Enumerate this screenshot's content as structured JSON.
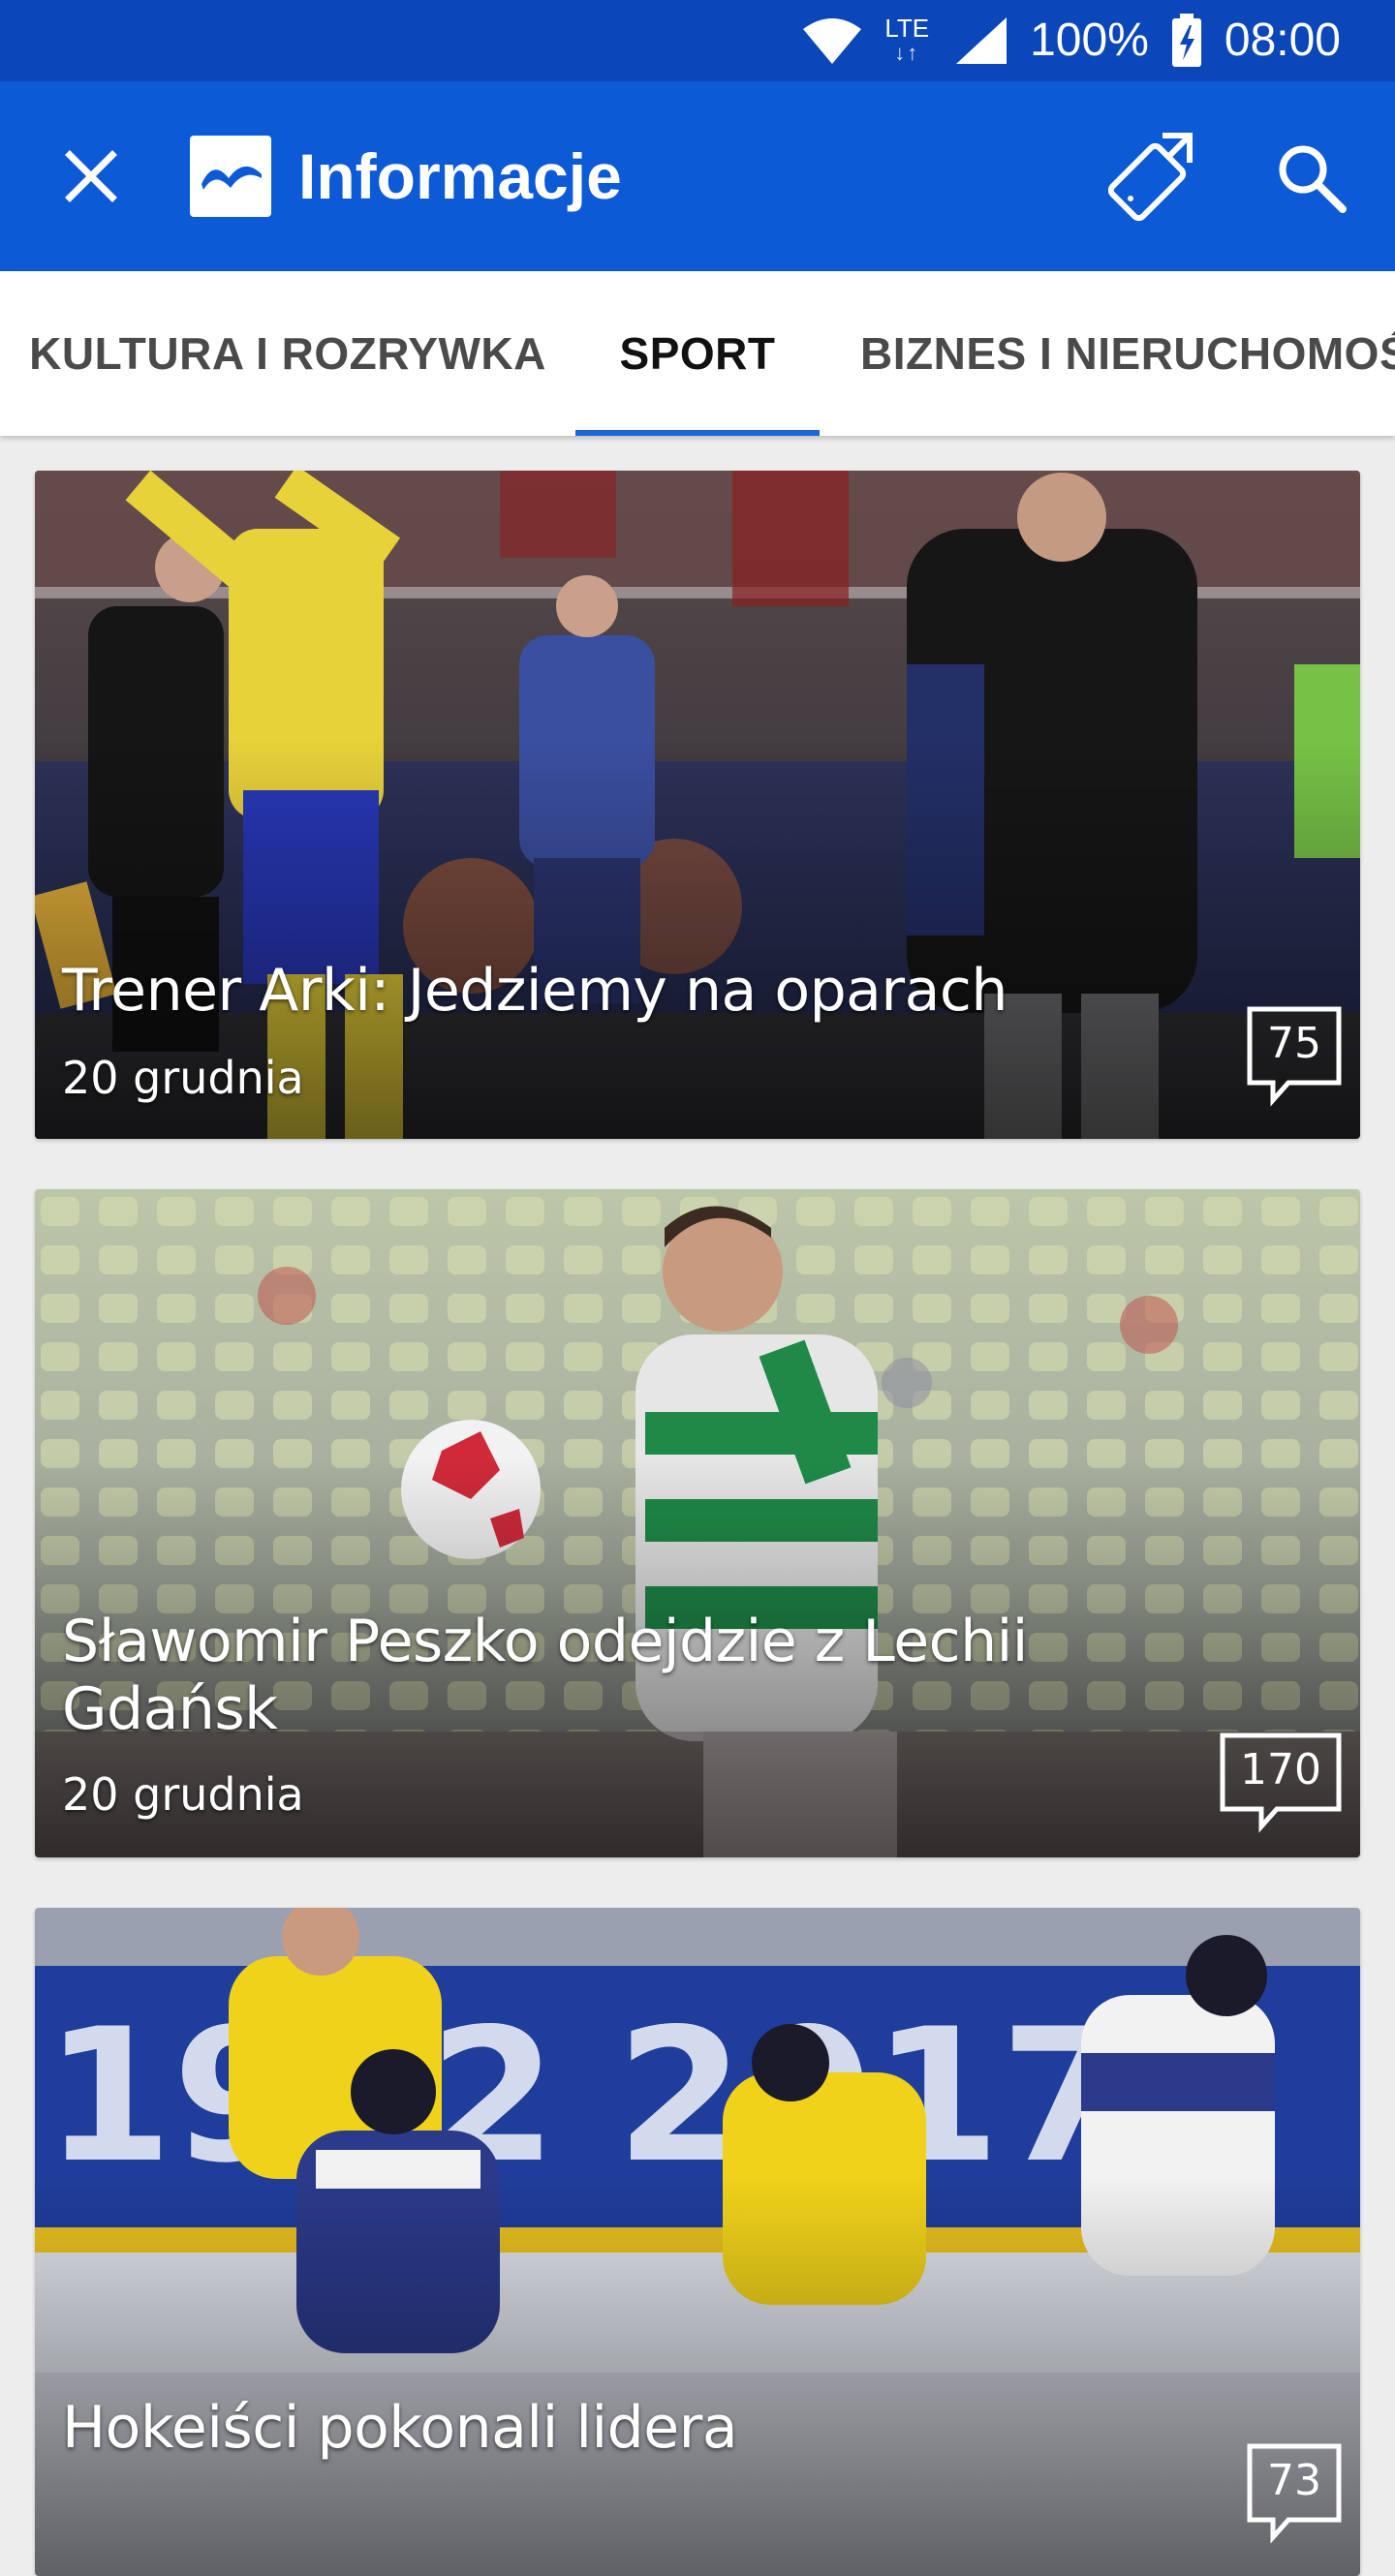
{
  "status_bar": {
    "network": "LTE",
    "battery": "100%",
    "time": "08:00"
  },
  "app_bar": {
    "title": "Informacje"
  },
  "tabs": [
    {
      "label": "KULTURA I ROZRYWKA",
      "active": false
    },
    {
      "label": "SPORT",
      "active": true
    },
    {
      "label": "BIZNES I NIERUCHOMOŚ",
      "active": false
    }
  ],
  "articles": [
    {
      "title": "Trener Arki: Jedziemy na oparach",
      "date": "20 grudnia",
      "comments": "75"
    },
    {
      "title": "Sławomir Peszko odejdzie z Lechii Gdańsk",
      "date": "20 grudnia",
      "comments": "170"
    },
    {
      "title": "Hokeiści pokonali lidera",
      "date": "",
      "comments": "73"
    }
  ],
  "colors": {
    "status_bar": "#0b47b8",
    "app_bar": "#0d5ad6",
    "tab_indicator": "#1a66d4"
  }
}
